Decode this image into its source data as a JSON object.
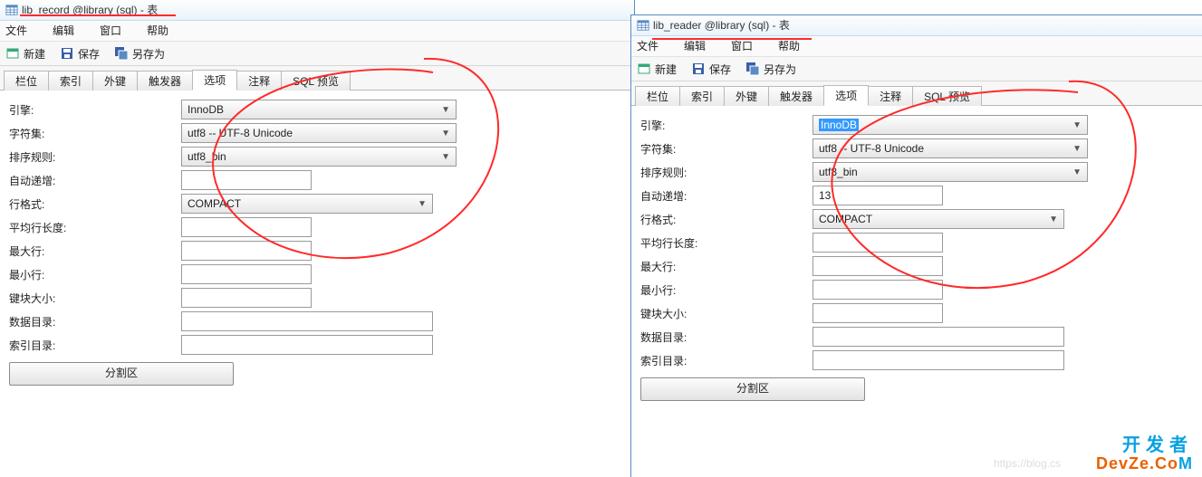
{
  "left": {
    "title": "lib_record @library (sql) - 表",
    "menu": {
      "file": "文件",
      "edit": "编辑",
      "window": "窗口",
      "help": "帮助"
    },
    "toolbar": {
      "new": "新建",
      "save": "保存",
      "saveas": "另存为"
    },
    "tabs": {
      "cols": "栏位",
      "index": "索引",
      "fk": "外键",
      "trigger": "触发器",
      "options": "选项",
      "comment": "注释",
      "sql": "SQL 预览"
    },
    "active_tab": "options",
    "form": {
      "engine_label": "引擎:",
      "engine": "InnoDB",
      "charset_label": "字符集:",
      "charset": "utf8 -- UTF-8 Unicode",
      "collation_label": "排序规则:",
      "collation": "utf8_bin",
      "autoinc_label": "自动递增:",
      "autoinc": "",
      "rowformat_label": "行格式:",
      "rowformat": "COMPACT",
      "avgrow_label": "平均行长度:",
      "avgrow": "",
      "maxrows_label": "最大行:",
      "maxrows": "",
      "minrows_label": "最小行:",
      "minrows": "",
      "keyblock_label": "键块大小:",
      "keyblock": "",
      "datadir_label": "数据目录:",
      "datadir": "",
      "indexdir_label": "索引目录:",
      "indexdir": "",
      "partition": "分割区"
    }
  },
  "right": {
    "title": "lib_reader @library (sql) - 表",
    "menu": {
      "file": "文件",
      "edit": "编辑",
      "window": "窗口",
      "help": "帮助"
    },
    "toolbar": {
      "new": "新建",
      "save": "保存",
      "saveas": "另存为"
    },
    "tabs": {
      "cols": "栏位",
      "index": "索引",
      "fk": "外键",
      "trigger": "触发器",
      "options": "选项",
      "comment": "注释",
      "sql": "SQL 预览"
    },
    "active_tab": "options",
    "form": {
      "engine_label": "引擎:",
      "engine": "InnoDB",
      "charset_label": "字符集:",
      "charset": "utf8 -- UTF-8 Unicode",
      "collation_label": "排序规则:",
      "collation": "utf8_bin",
      "autoinc_label": "自动递增:",
      "autoinc": "13",
      "rowformat_label": "行格式:",
      "rowformat": "COMPACT",
      "avgrow_label": "平均行长度:",
      "avgrow": "",
      "maxrows_label": "最大行:",
      "maxrows": "",
      "minrows_label": "最小行:",
      "minrows": "",
      "keyblock_label": "键块大小:",
      "keyblock": "",
      "datadir_label": "数据目录:",
      "datadir": "",
      "indexdir_label": "索引目录:",
      "indexdir": "",
      "partition": "分割区"
    }
  },
  "watermark": {
    "cn": "开发者",
    "en_prefix": "DevZe.Co",
    "en_suffix": "M",
    "blog": "https://blog.cs"
  }
}
